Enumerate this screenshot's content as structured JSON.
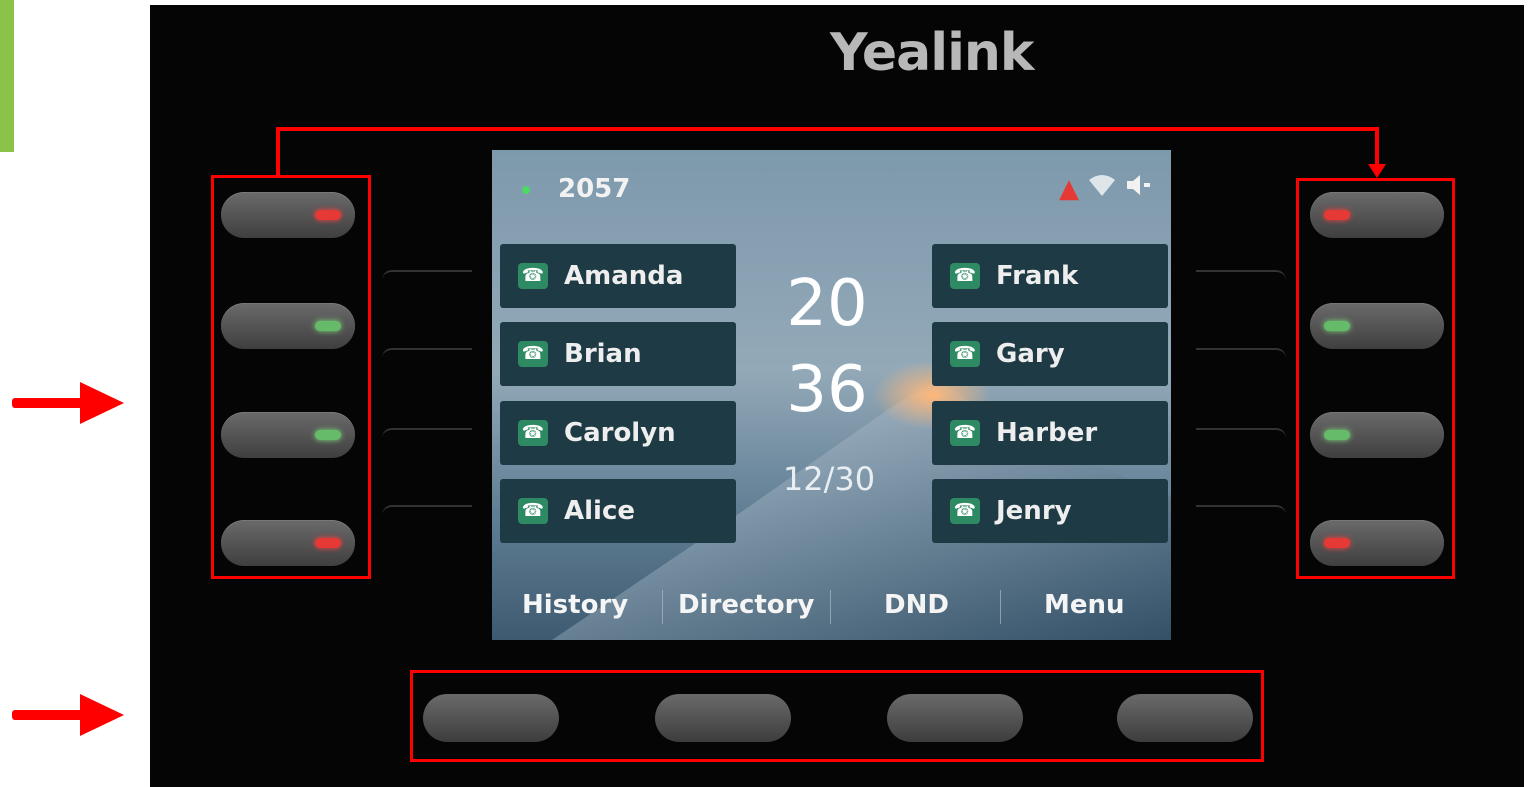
{
  "brand": {
    "logo": "Yealink"
  },
  "screen": {
    "extension": "2057",
    "status_icons": [
      "alert-icon",
      "wifi-icon",
      "speaker-icon"
    ],
    "left_lines": [
      "Amanda",
      "Brian",
      "Carolyn",
      "Alice"
    ],
    "right_lines": [
      "Frank",
      "Gary",
      "Harber",
      "Jenry"
    ],
    "time_hour": "20",
    "time_minute": "36",
    "date": "12/30",
    "softkeys": [
      "History",
      "Directory",
      "DND",
      "Menu"
    ]
  },
  "leds": {
    "left": [
      "red",
      "green",
      "green",
      "red"
    ],
    "right": [
      "red",
      "green",
      "green",
      "red"
    ]
  },
  "colors": {
    "highlight": "#ff0000",
    "led_green": "#66bb6a",
    "led_red": "#e53935",
    "accent_green": "#8bc34a"
  }
}
